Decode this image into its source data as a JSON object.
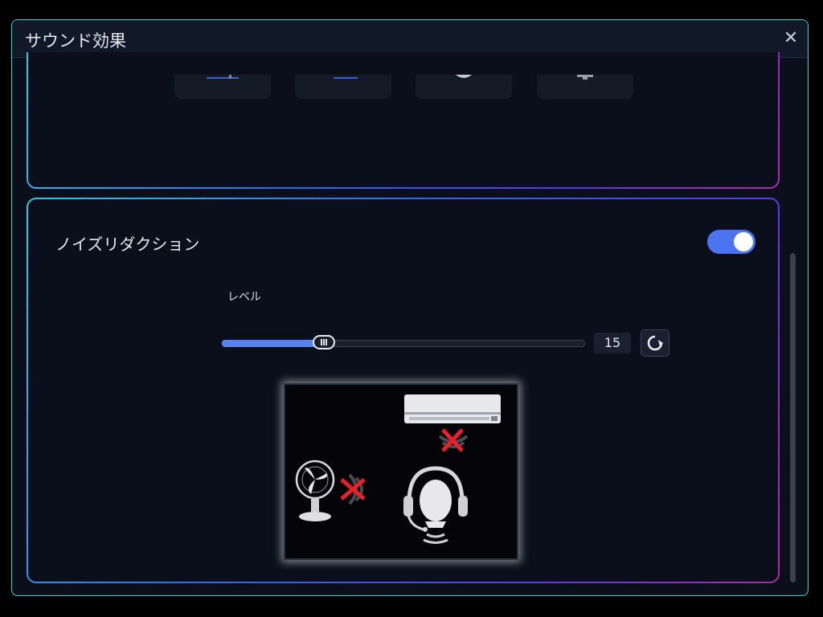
{
  "window": {
    "title": "サウンド効果",
    "close_glyph": "✕"
  },
  "noise_reduction": {
    "label": "ノイズリダクション",
    "enabled": true,
    "level_label": "レベル",
    "level_value": "15",
    "level_fraction": 0.28
  },
  "icons": {
    "close": "close-icon",
    "reset": "reset-icon",
    "fan": "fan-icon",
    "air_conditioner": "air-conditioner-icon",
    "headset": "headset-icon",
    "blocked": "red-x-icon"
  },
  "colors": {
    "accent": "#4c74f0",
    "window_border": "#35d6d0",
    "blocked": "#e8202a"
  }
}
